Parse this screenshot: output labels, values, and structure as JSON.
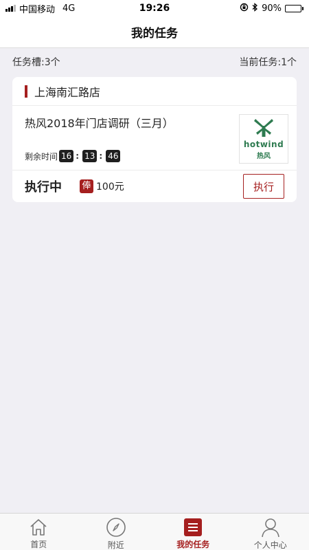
{
  "status_bar": {
    "carrier": "中国移动",
    "network": "4G",
    "time": "19:26",
    "battery": "90%",
    "battery_level": 0.9
  },
  "nav": {
    "title": "我的任务"
  },
  "summary": {
    "slots": "任务槽:3个",
    "current": "当前任务:1个"
  },
  "task": {
    "store": "上海南汇路店",
    "title": "热风2018年门店调研（三月）",
    "remaining_label": "剩余时间",
    "countdown": {
      "hours": "16",
      "minutes": "13",
      "seconds": "46",
      "sep": ":"
    },
    "logo": {
      "brand": "hotwind",
      "brand_cn": "热风"
    },
    "status": "执行中",
    "reward_badge": "俸",
    "reward": "100元",
    "action_label": "执行"
  },
  "tabs": [
    {
      "label": "首页",
      "icon": "home-icon",
      "active": false
    },
    {
      "label": "附近",
      "icon": "compass-icon",
      "active": false
    },
    {
      "label": "我的任务",
      "icon": "list-icon",
      "active": true
    },
    {
      "label": "个人中心",
      "icon": "person-icon",
      "active": false
    }
  ],
  "colors": {
    "accent": "#a51f1f",
    "brand_green": "#2e7b50",
    "background": "#f0eff4"
  }
}
